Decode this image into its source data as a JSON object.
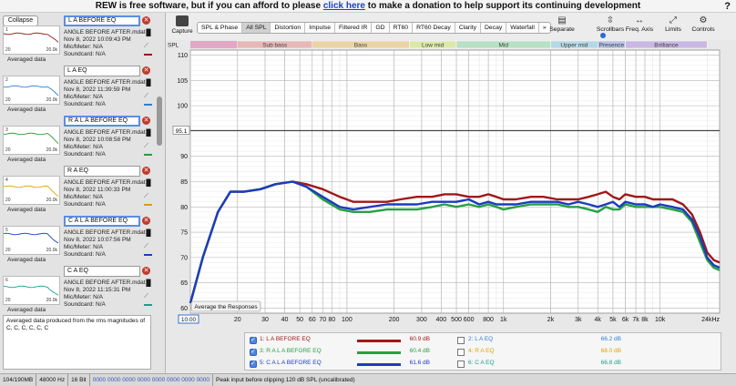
{
  "banner": {
    "pre": "REW is free software, but if you can afford to please ",
    "link": "click here",
    "post": " to make a donation to help support its continuing development",
    "help_glyph": "?"
  },
  "left_panel": {
    "collapse_label": "Collapse",
    "measurements": [
      {
        "name": "L A BEFORE EQ",
        "selected": true,
        "file": "ANGLE BEFORE AFTER.mdat",
        "date": "Nov 8, 2022 10:09:43 PM",
        "mic": "Mic/Meter: N/A",
        "soundcard": "Soundcard: N/A",
        "avg": "Averaged data",
        "color": "#8b1a1a",
        "num": "1"
      },
      {
        "name": "L A EQ",
        "selected": false,
        "file": "ANGLE BEFORE AFTER.mdat",
        "date": "Nov 8, 2022 11:39:59 PM",
        "mic": "Mic/Meter: N/A",
        "soundcard": "Soundcard: N/A",
        "avg": "Averaged data",
        "color": "#2f7ed8",
        "num": "2"
      },
      {
        "name": "R A L A BEFORE EQ",
        "selected": true,
        "file": "ANGLE BEFORE AFTER.mdat",
        "date": "Nov 8, 2022 10:08:58 PM",
        "mic": "Mic/Meter: N/A",
        "soundcard": "Soundcard: N/A",
        "avg": "Averaged data",
        "color": "#2e9b3a",
        "num": "3"
      },
      {
        "name": "R A EQ",
        "selected": false,
        "file": "ANGLE BEFORE AFTER.mdat",
        "date": "Nov 8, 2022 11:00:33 PM",
        "mic": "Mic/Meter: N/A",
        "soundcard": "Soundcard: N/A",
        "avg": "Averaged data",
        "color": "#e0a000",
        "num": "4"
      },
      {
        "name": "C A L A BEFORE EQ",
        "selected": true,
        "file": "ANGLE BEFORE AFTER.mdat",
        "date": "Nov 8, 2022 10:07:56 PM",
        "mic": "Mic/Meter: N/A",
        "soundcard": "Soundcard: N/A",
        "avg": "Averaged data",
        "color": "#1a3fbf",
        "num": "5"
      },
      {
        "name": "C A EQ",
        "selected": false,
        "file": "ANGLE BEFORE AFTER.mdat",
        "date": "Nov 8, 2022 11:15:31 PM",
        "mic": "Mic/Meter: N/A",
        "soundcard": "Soundcard: N/A",
        "avg": "Averaged data",
        "color": "#1a9e8f",
        "num": "6"
      }
    ],
    "thumb_axis": {
      "left": "20",
      "right": "20.0k"
    },
    "notes": "Averaged data produced from the rms magnitudes of C, C, C, C, C, C"
  },
  "toolbar": {
    "capture_label": "Capture",
    "tabs": [
      {
        "label": "SPL & Phase",
        "active": false
      },
      {
        "label": "All SPL",
        "active": true
      },
      {
        "label": "Distortion",
        "active": false
      },
      {
        "label": "Impulse",
        "active": false
      },
      {
        "label": "Filtered IR",
        "active": false
      },
      {
        "label": "GD",
        "active": false
      },
      {
        "label": "RT60",
        "active": false
      },
      {
        "label": "RT60 Decay",
        "active": false
      },
      {
        "label": "Clarity",
        "active": false
      },
      {
        "label": "Decay",
        "active": false
      },
      {
        "label": "Waterfall",
        "active": false
      },
      {
        "label": "»",
        "active": false
      }
    ],
    "tools": [
      {
        "label": "Separate",
        "icon": "separate-icon",
        "glyph": "▤"
      },
      {
        "label": "Scrollbars",
        "icon": "scrollbars-icon",
        "glyph": "⇳"
      },
      {
        "label": "Freq. Axis",
        "icon": "freq-axis-icon",
        "glyph": "↔"
      },
      {
        "label": "Limits",
        "icon": "limits-icon",
        "glyph": "⤢"
      },
      {
        "label": "Controls",
        "icon": "controls-icon",
        "glyph": "⚙"
      }
    ]
  },
  "graph": {
    "y_unit": "SPL",
    "cursor_level": "95.1",
    "start_field": "10.00",
    "average_button": "Average the Responses",
    "bands": [
      {
        "label": "Sub bass",
        "from": 20,
        "to": 60,
        "color": "#e6b8b8"
      },
      {
        "label": "Bass",
        "from": 60,
        "to": 250,
        "color": "#ead3a6"
      },
      {
        "label": "Low mid",
        "from": 250,
        "to": 500,
        "color": "#dbe8a8"
      },
      {
        "label": "Mid",
        "from": 500,
        "to": 2000,
        "color": "#b7e0c4"
      },
      {
        "label": "Upper mid",
        "from": 2000,
        "to": 4000,
        "color": "#b5d8e5"
      },
      {
        "label": "Presence",
        "from": 4000,
        "to": 6000,
        "color": "#b7c2e8"
      },
      {
        "label": "Brilliance",
        "from": 6000,
        "to": 20000,
        "color": "#c9b8e3"
      }
    ],
    "band_left_color": "#e2a8c6"
  },
  "chart_data": {
    "type": "line",
    "x_scale": "log",
    "xlim": [
      10,
      24000
    ],
    "ylim": [
      59,
      111
    ],
    "xlabel": "",
    "ylabel": "SPL",
    "x_ticks": [
      {
        "v": 20,
        "l": "20"
      },
      {
        "v": 30,
        "l": "30"
      },
      {
        "v": 40,
        "l": "40"
      },
      {
        "v": 50,
        "l": "50"
      },
      {
        "v": 60,
        "l": "60"
      },
      {
        "v": 70,
        "l": "70"
      },
      {
        "v": 80,
        "l": "80"
      },
      {
        "v": 100,
        "l": "100"
      },
      {
        "v": 200,
        "l": "200"
      },
      {
        "v": 300,
        "l": "300"
      },
      {
        "v": 400,
        "l": "400"
      },
      {
        "v": 500,
        "l": "500"
      },
      {
        "v": 600,
        "l": "600"
      },
      {
        "v": 800,
        "l": "800"
      },
      {
        "v": 1000,
        "l": "1k"
      },
      {
        "v": 2000,
        "l": "2k"
      },
      {
        "v": 3000,
        "l": "3k"
      },
      {
        "v": 4000,
        "l": "4k"
      },
      {
        "v": 5000,
        "l": "5k"
      },
      {
        "v": 6000,
        "l": "6k"
      },
      {
        "v": 7000,
        "l": "7k"
      },
      {
        "v": 8000,
        "l": "8k"
      },
      {
        "v": 10000,
        "l": "10k"
      },
      {
        "v": 24000,
        "l": "24kHz"
      }
    ],
    "y_ticks": [
      60,
      65,
      70,
      75,
      80,
      85,
      90,
      95,
      100,
      105,
      110
    ],
    "grid": true,
    "series": [
      {
        "name": "1: L A BEFORE EQ",
        "color": "#a01818",
        "x": [
          10,
          12,
          15,
          18,
          22,
          28,
          35,
          45,
          55,
          70,
          90,
          110,
          140,
          180,
          220,
          280,
          350,
          420,
          500,
          600,
          700,
          800,
          900,
          1000,
          1200,
          1500,
          1800,
          2200,
          2600,
          3000,
          3500,
          4000,
          4500,
          5000,
          5500,
          6000,
          7000,
          8000,
          9000,
          10000,
          12000,
          14000,
          16000,
          18000,
          20000,
          22000,
          24000
        ],
        "y": [
          61,
          70,
          79,
          83,
          83,
          83.5,
          84.5,
          85,
          84.5,
          83.5,
          82,
          81,
          81,
          81,
          81.5,
          82,
          82,
          82.5,
          82.5,
          82,
          82,
          82.5,
          82,
          81.5,
          81.5,
          82,
          82,
          81.5,
          81.5,
          81.5,
          82,
          82.5,
          83,
          82,
          81.5,
          82.5,
          82,
          82,
          81.5,
          81.5,
          81.5,
          80.5,
          78.5,
          75,
          71,
          69.5,
          69
        ]
      },
      {
        "name": "3: R A L A BEFORE EQ",
        "color": "#27a043",
        "x": [
          10,
          12,
          15,
          18,
          22,
          28,
          35,
          45,
          55,
          70,
          90,
          110,
          140,
          180,
          220,
          280,
          350,
          420,
          500,
          600,
          700,
          800,
          900,
          1000,
          1200,
          1500,
          1800,
          2200,
          2600,
          3000,
          3500,
          4000,
          4500,
          5000,
          5500,
          6000,
          7000,
          8000,
          9000,
          10000,
          12000,
          14000,
          16000,
          18000,
          20000,
          22000,
          24000
        ],
        "y": [
          61,
          70,
          79,
          83,
          83,
          83.5,
          84.5,
          85,
          84,
          81.5,
          79.5,
          79,
          79,
          79.5,
          79.5,
          79.5,
          80,
          80.5,
          80,
          80.5,
          80,
          80.5,
          80,
          79.5,
          80,
          80.5,
          80.5,
          80.5,
          80,
          80,
          79.5,
          79,
          80,
          79.5,
          79.5,
          80.5,
          80,
          80,
          80,
          80,
          79.5,
          79,
          77,
          73,
          69.5,
          68,
          67.5
        ]
      },
      {
        "name": "5: C A L A BEFORE EQ",
        "color": "#1b3cbf",
        "x": [
          10,
          12,
          15,
          18,
          22,
          28,
          35,
          45,
          55,
          70,
          90,
          110,
          140,
          180,
          220,
          280,
          350,
          420,
          500,
          600,
          700,
          800,
          900,
          1000,
          1200,
          1500,
          1800,
          2200,
          2600,
          3000,
          3500,
          4000,
          4500,
          5000,
          5500,
          6000,
          7000,
          8000,
          9000,
          10000,
          12000,
          14000,
          16000,
          18000,
          20000,
          22000,
          24000
        ],
        "y": [
          61,
          70,
          79,
          83,
          83,
          83.5,
          84.5,
          85,
          84,
          82,
          80,
          79.5,
          80,
          80.5,
          80.5,
          80.5,
          81,
          81,
          81,
          81.5,
          80.5,
          81,
          80.5,
          80.5,
          80.5,
          81,
          81,
          81,
          80.5,
          81,
          80.5,
          80,
          80.5,
          81,
          80,
          81,
          80.5,
          80.5,
          80,
          80.5,
          80,
          79.5,
          77.5,
          74,
          70,
          68.5,
          68
        ]
      }
    ]
  },
  "legend": {
    "rows": [
      {
        "left": {
          "label": "1: L A BEFORE EQ",
          "checked": true,
          "color": "#a01818",
          "db": "60.9 dB"
        },
        "right": {
          "label": "2: L A EQ",
          "checked": false,
          "color": "#2f7ed8",
          "db": "66.2 dB"
        }
      },
      {
        "left": {
          "label": "3: R A L A BEFORE EQ",
          "checked": true,
          "color": "#27a043",
          "db": "60.4 dB"
        },
        "right": {
          "label": "4: R A EQ",
          "checked": false,
          "color": "#e0a000",
          "db": "68.0 dB"
        }
      },
      {
        "left": {
          "label": "5: C A L A BEFORE EQ",
          "checked": true,
          "color": "#1b3cbf",
          "db": "61.6 dB"
        },
        "right": {
          "label": "6: C A EQ",
          "checked": false,
          "color": "#1a9e8f",
          "db": "66.8 dB"
        }
      }
    ]
  },
  "status": {
    "memory": "104/190MB",
    "rate": "48000 Hz",
    "bits": "16 Bit",
    "meter": "0000 0000 0000 0000 0000 0000 0000 0000",
    "peak": "Peak input before clipping 120 dB SPL (uncalibrated)"
  }
}
